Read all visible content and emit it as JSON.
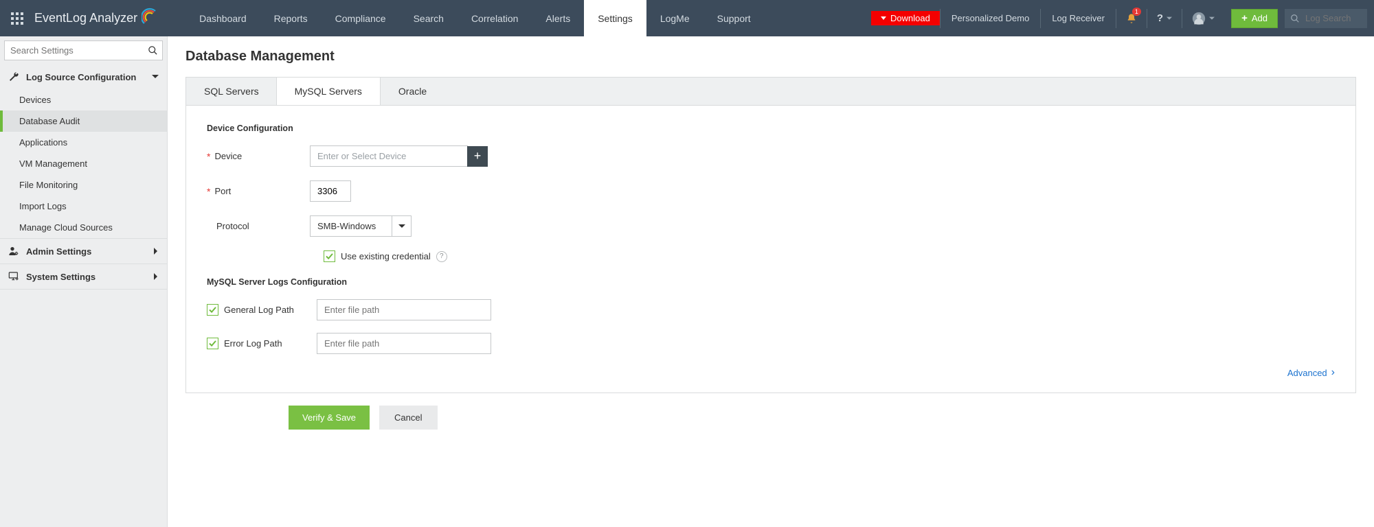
{
  "header": {
    "app_name": "EventLog Analyzer",
    "nav": [
      "Dashboard",
      "Reports",
      "Compliance",
      "Search",
      "Correlation",
      "Alerts",
      "Settings",
      "LogMe",
      "Support"
    ],
    "active_nav": "Settings",
    "download": "Download",
    "links": [
      "Personalized Demo",
      "Log Receiver"
    ],
    "notif_count": "1",
    "add_label": "Add",
    "log_search_placeholder": "Log Search"
  },
  "sidebar": {
    "search_placeholder": "Search Settings",
    "sections": [
      {
        "title": "Log Source Configuration",
        "expanded": true,
        "items": [
          "Devices",
          "Database Audit",
          "Applications",
          "VM Management",
          "File Monitoring",
          "Import Logs",
          "Manage Cloud Sources"
        ],
        "active": "Database Audit"
      },
      {
        "title": "Admin Settings",
        "expanded": false
      },
      {
        "title": "System Settings",
        "expanded": false
      }
    ]
  },
  "page": {
    "title": "Database Management",
    "tabs": [
      "SQL Servers",
      "MySQL Servers",
      "Oracle"
    ],
    "active_tab": "MySQL Servers",
    "device_config": {
      "heading": "Device Configuration",
      "device_label": "Device",
      "device_placeholder": "Enter or Select Device",
      "port_label": "Port",
      "port_value": "3306",
      "protocol_label": "Protocol",
      "protocol_value": "SMB-Windows",
      "use_existing_label": "Use existing credential"
    },
    "logs_config": {
      "heading": "MySQL Server Logs Configuration",
      "general_label": "General Log Path",
      "general_placeholder": "Enter file path",
      "error_label": "Error Log Path",
      "error_placeholder": "Enter file path"
    },
    "advanced_label": "Advanced",
    "verify_label": "Verify & Save",
    "cancel_label": "Cancel"
  }
}
